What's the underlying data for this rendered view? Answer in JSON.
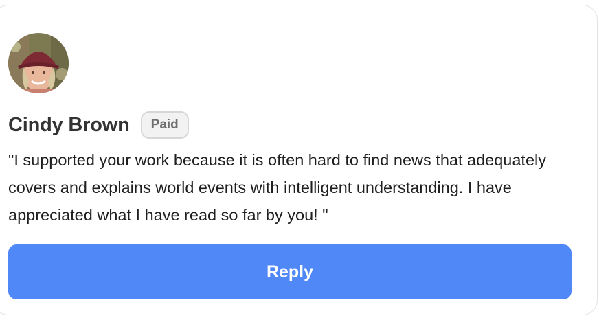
{
  "comment": {
    "author_name": "Cindy Brown",
    "badge": "Paid",
    "avatar_icon": "user-photo",
    "message": "\"I supported your work because it is often hard to find news that adequately covers and explains world events with intelligent understanding. I have appreciated what I have read so far by you! \"",
    "reply_label": "Reply"
  },
  "colors": {
    "accent": "#5089f7",
    "badge_bg": "#f2f2f2",
    "badge_border": "#d6d6d6",
    "name_text": "#333333",
    "card_border": "#e2e2e2"
  }
}
